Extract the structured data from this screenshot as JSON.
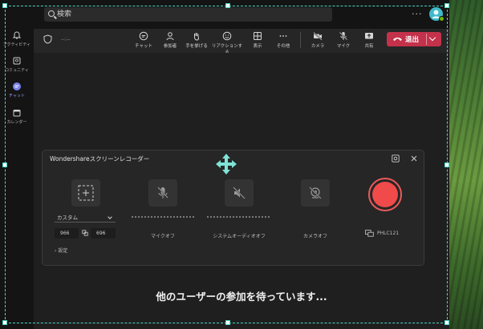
{
  "search": {
    "placeholder": "検索"
  },
  "topbar": {
    "more": "···"
  },
  "rail": [
    {
      "label": "アクティビティ"
    },
    {
      "label": "コミュニティ"
    },
    {
      "label": "チャット"
    },
    {
      "label": "カレンダー"
    }
  ],
  "meeting": {
    "timer": "--:--"
  },
  "toolbar": {
    "chat": "チャット",
    "people": "参加者",
    "raise_hand": "手を挙げる",
    "reactions": "リアクションする",
    "view": "表示",
    "more": "その他",
    "camera": "カメラ",
    "mic": "マイク",
    "share": "共有",
    "leave": "退出"
  },
  "recorder": {
    "title": "Wondershareスクリーンレコーダー",
    "preset": "カスタム",
    "width": "966",
    "height": "696",
    "settings": "設定",
    "mic_off": "マイクオフ",
    "system_audio_off": "システムオーディオオフ",
    "camera_off": "カメラオフ",
    "device": "PHLC121"
  },
  "stage": {
    "waiting": "他のユーザーの参加を待っています..."
  },
  "colors": {
    "leave": "#c4314b",
    "record": "#f04a4a",
    "frame": "#4fd6c6",
    "accent": "#4f52b2"
  }
}
